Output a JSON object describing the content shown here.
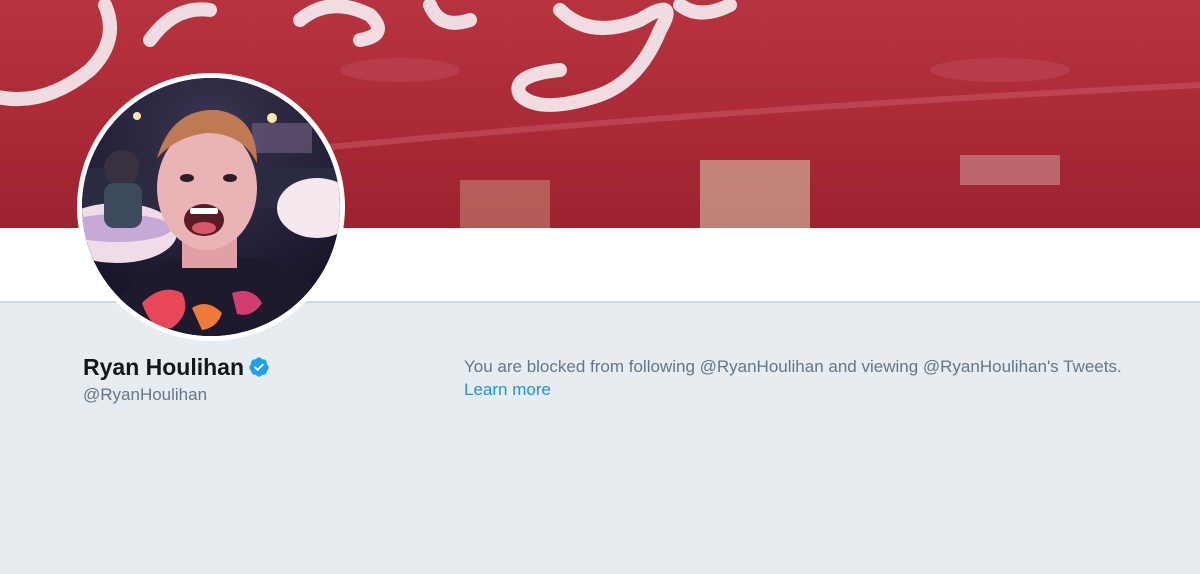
{
  "profile": {
    "full_name": "Ryan Houlihan",
    "screen_name": "@RyanHoulihan",
    "verified": true
  },
  "block_notice": {
    "message": "You are blocked from following @RyanHoulihan and viewing @RyanHoulihan's Tweets.",
    "link_label": "Learn more"
  },
  "colors": {
    "page_background": "#e6ecf0",
    "banner_red": "#ab2a36",
    "link_blue": "#1b95e0",
    "verified_blue": "#1da1f2",
    "secondary_text": "#657786",
    "primary_text": "#14171a"
  },
  "icons": {
    "verified": "verified-badge-icon"
  }
}
